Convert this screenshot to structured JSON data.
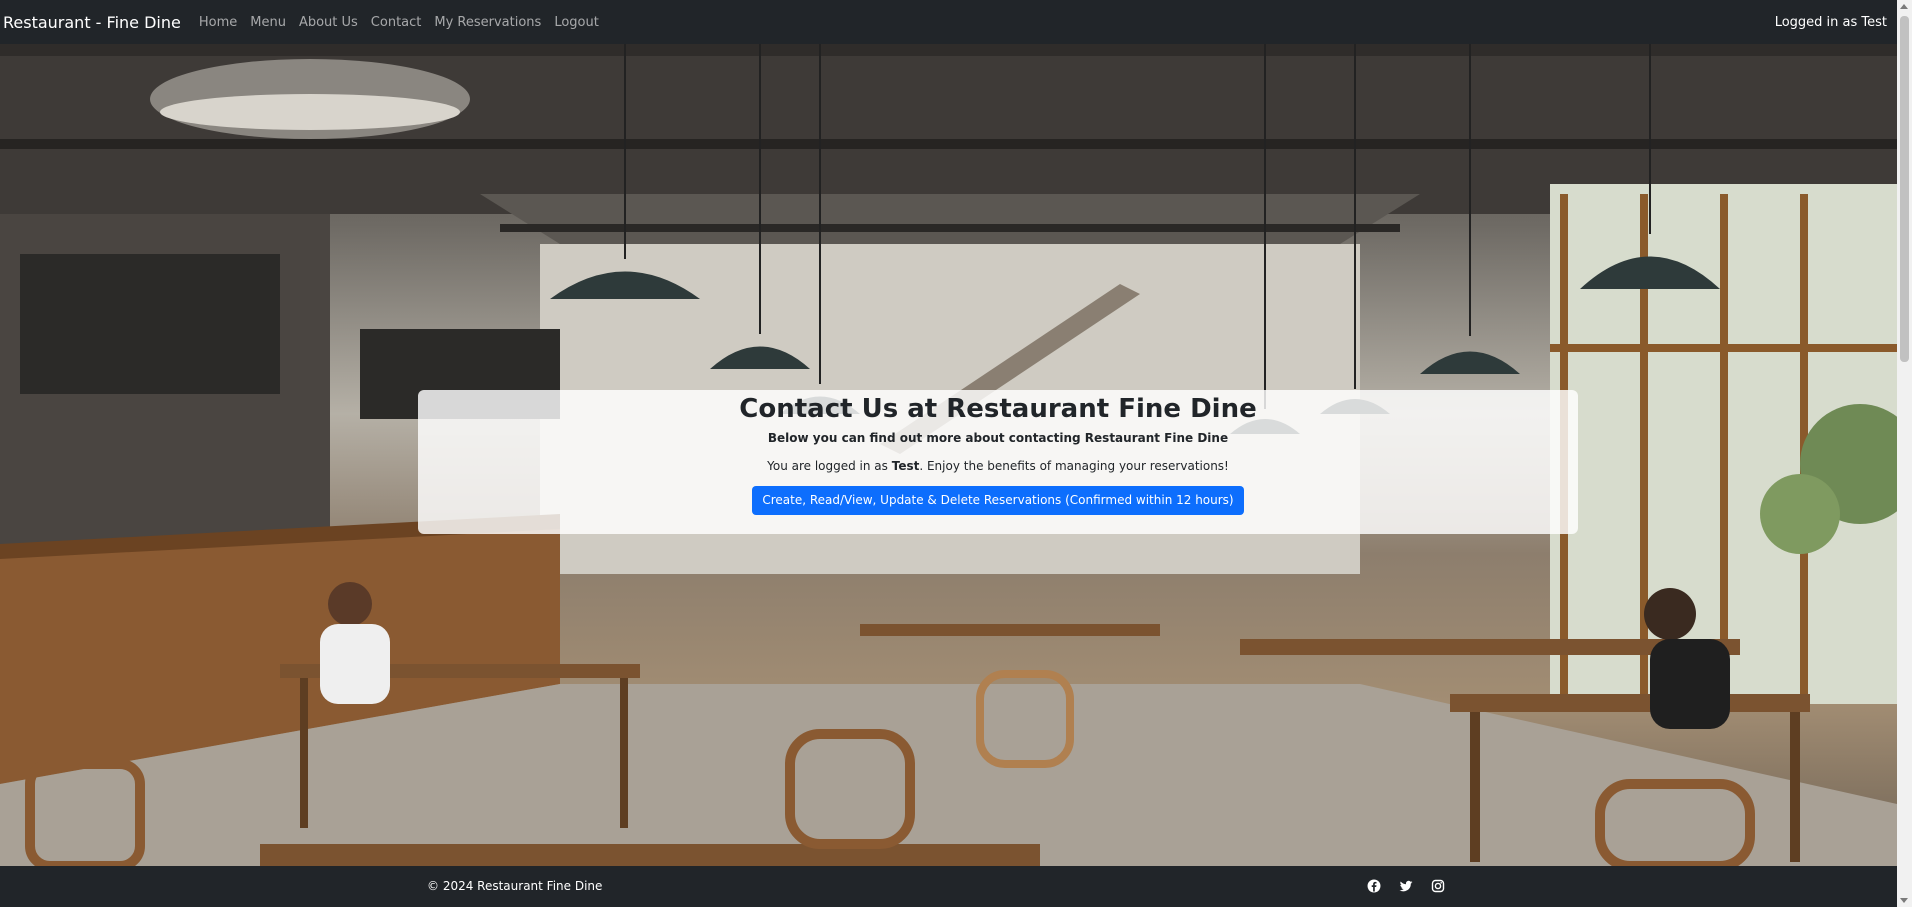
{
  "navbar": {
    "brand": "Restaurant - Fine Dine",
    "links": [
      "Home",
      "Menu",
      "About Us",
      "Contact",
      "My Reservations",
      "Logout"
    ],
    "status": "Logged in as Test"
  },
  "card": {
    "title": "Contact Us at Restaurant Fine Dine",
    "subtitle": "Below you can find out more about contacting Restaurant Fine Dine",
    "text_prefix": "You are logged in as ",
    "username": "Test",
    "text_suffix": ". Enjoy the benefits of managing your reservations!",
    "button_label": "Create, Read/View, Update & Delete Reservations (Confirmed within 12 hours)"
  },
  "footer": {
    "copyright": "© 2024 Restaurant Fine Dine",
    "social_icons": [
      "facebook-icon",
      "twitter-icon",
      "instagram-icon"
    ]
  },
  "colors": {
    "navbar_bg": "#212529",
    "button_bg": "#0d6efd",
    "card_bg": "rgba(255,255,255,0.82)"
  }
}
